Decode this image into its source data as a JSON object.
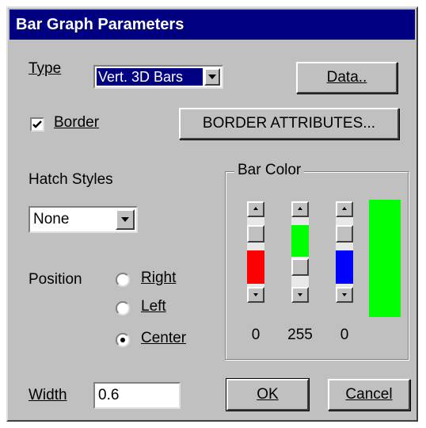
{
  "dialog": {
    "title": "Bar Graph Parameters"
  },
  "type": {
    "label": "Type",
    "value": "Vert. 3D Bars"
  },
  "data_button": {
    "label": "Data.."
  },
  "border": {
    "label": "Border",
    "checked": true
  },
  "border_attributes_button": {
    "label": "BORDER ATTRIBUTES..."
  },
  "hatch": {
    "label": "Hatch Styles",
    "value": "None"
  },
  "position": {
    "label": "Position",
    "options": [
      {
        "label": "Right",
        "selected": false
      },
      {
        "label": "Left",
        "selected": false
      },
      {
        "label": "Center",
        "selected": true
      }
    ]
  },
  "bar_color": {
    "label": "Bar Color",
    "channels": [
      {
        "value": "0",
        "color": "#ff0000",
        "level": 0
      },
      {
        "value": "255",
        "color": "#00ff00",
        "level": 255
      },
      {
        "value": "0",
        "color": "#0000ff",
        "level": 0
      }
    ],
    "swatch_color": "#00ff00"
  },
  "width": {
    "label": "Width",
    "value": "0.6"
  },
  "ok_button": {
    "label": "OK"
  },
  "cancel_button": {
    "label": "Cancel"
  }
}
